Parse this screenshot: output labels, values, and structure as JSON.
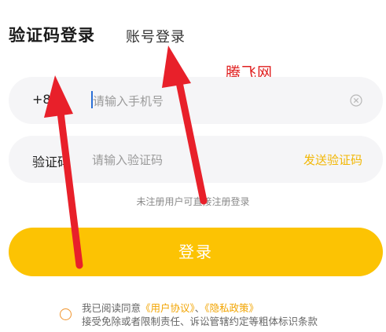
{
  "tabs": {
    "active_label": "验证码登录",
    "inactive_label": "账号登录"
  },
  "watermark": "腾飞网",
  "phone": {
    "prefix": "+86",
    "placeholder": "请输入手机号",
    "clear_icon": "clear-circle-icon"
  },
  "code": {
    "label": "验证码",
    "placeholder": "请输入验证码",
    "send_label": "发送验证码"
  },
  "hint": "未注册用户可直接注册登录",
  "login_label": "登录",
  "agreement": {
    "prefix": "我已阅读同意",
    "user_agreement": "《用户协议》",
    "separator": "、",
    "privacy_policy": "《隐私政策》",
    "line2": "接受免除或者限制责任、诉讼管辖约定等粗体标识条款"
  },
  "colors": {
    "accent": "#fcc303",
    "link": "#f2a400",
    "annotation_arrow": "#e8202a"
  }
}
